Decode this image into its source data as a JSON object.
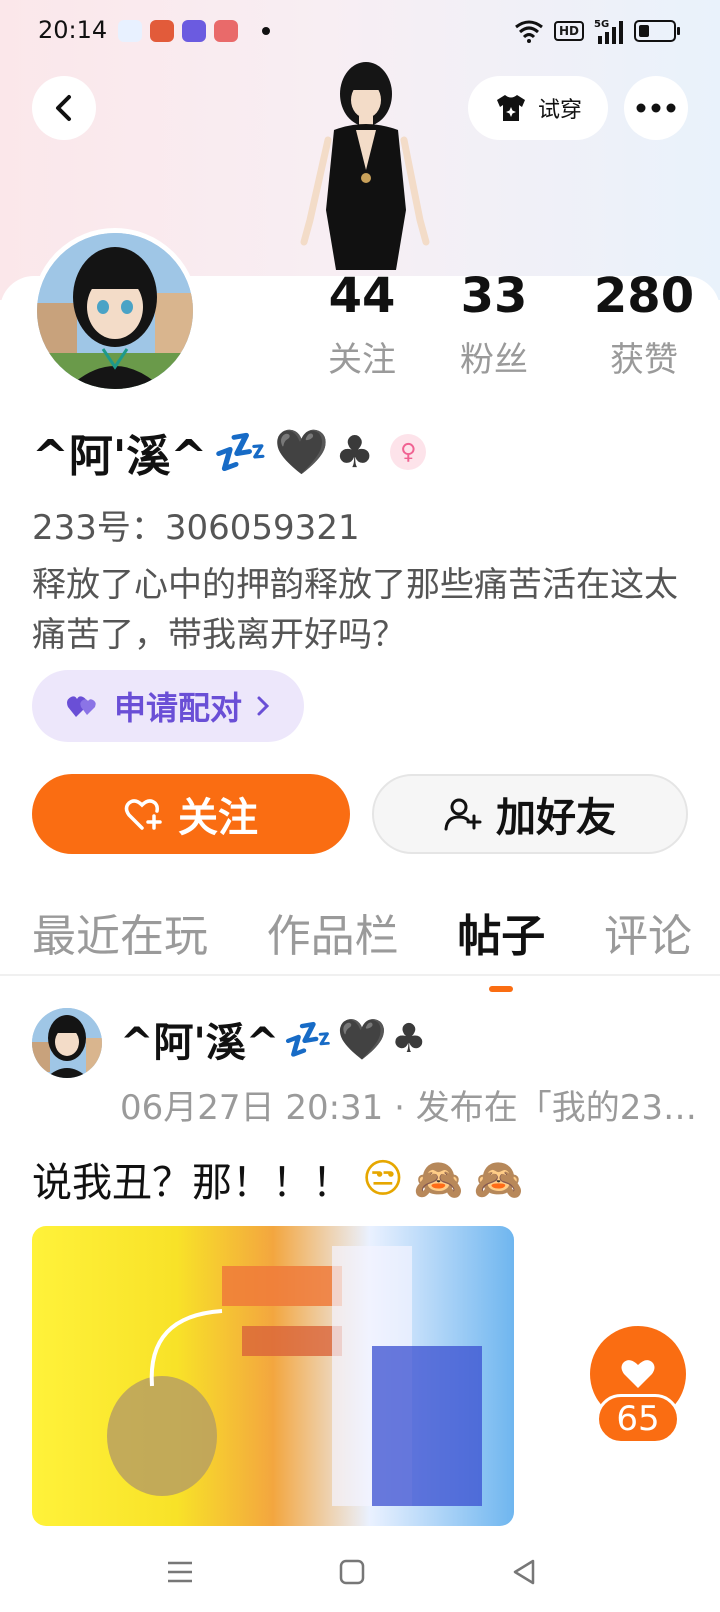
{
  "status_bar": {
    "time": "20:14",
    "network": "5G",
    "hd": "HD",
    "battery_percent": 30
  },
  "header": {
    "try_on_label": "试穿"
  },
  "profile": {
    "nickname": "^阿'溪^",
    "nickname_emojis": [
      "💤",
      "🖤",
      "♣"
    ],
    "uid": "233号：306059321",
    "bio": "释放了心中的押韵释放了那些痛苦活在这太痛苦了，带我离开好吗？",
    "stats": [
      {
        "value": "44",
        "label": "关注"
      },
      {
        "value": "33",
        "label": "粉丝"
      },
      {
        "value": "280",
        "label": "获赞"
      }
    ]
  },
  "actions": {
    "pair_label": "申请配对",
    "follow_label": "关注",
    "add_friend_label": "加好友"
  },
  "tabs": [
    {
      "label": "最近在玩",
      "active": false
    },
    {
      "label": "作品栏",
      "active": false
    },
    {
      "label": "帖子",
      "active": true
    },
    {
      "label": "评论",
      "active": false
    }
  ],
  "post": {
    "author": "^阿'溪^",
    "author_emojis": [
      "💤",
      "🖤",
      "♣"
    ],
    "meta": "06月27日 20:31 · 发布在「我的23…",
    "text": "说我丑？那！！！",
    "text_emojis": [
      "😒",
      "🙈",
      "🙈"
    ],
    "likes": "65"
  },
  "colors": {
    "accent": "#fa6d12",
    "pair_purple": "#6a4fd6",
    "muted": "#9a9a9a"
  }
}
